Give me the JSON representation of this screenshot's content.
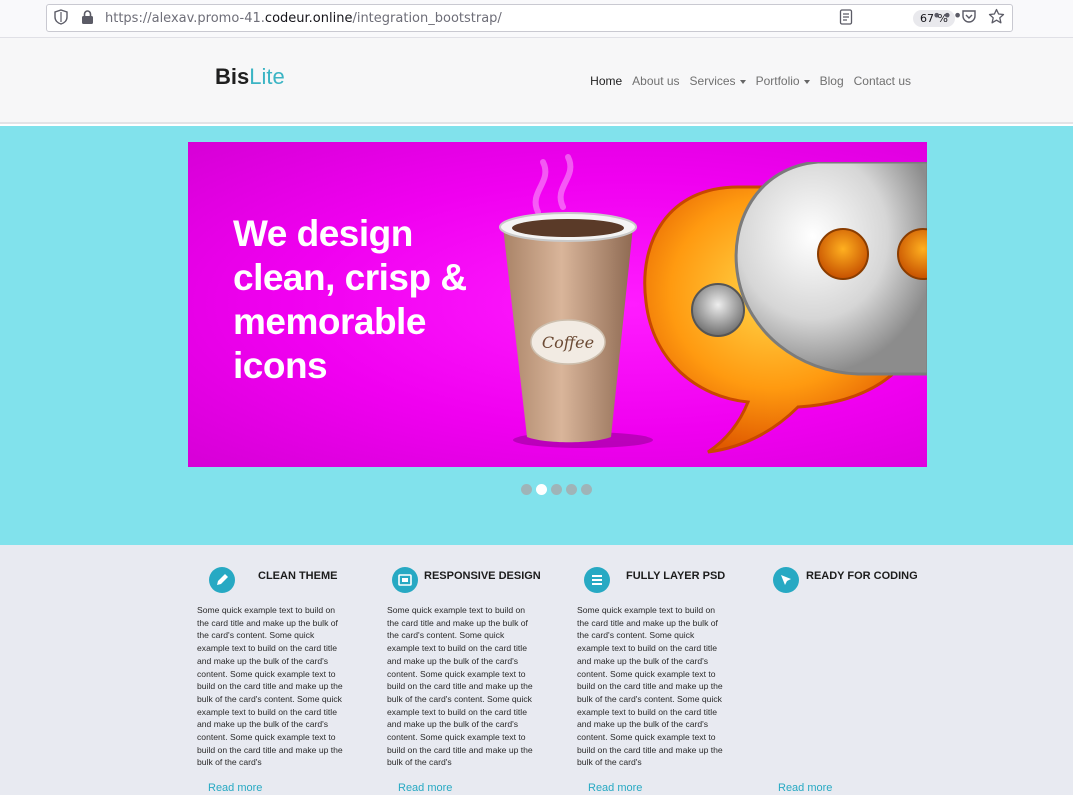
{
  "browser": {
    "url_prefix": "https://alexav.promo-41.",
    "url_domain": "codeur.online",
    "url_path": "/integration_bootstrap/",
    "zoom": "67 %"
  },
  "site": {
    "logo_bold": "Bis",
    "logo_light": "Lite",
    "nav": [
      {
        "label": "Home"
      },
      {
        "label": "About us"
      },
      {
        "label": "Services"
      },
      {
        "label": "Portfolio"
      },
      {
        "label": "Blog"
      },
      {
        "label": "Contact us"
      }
    ]
  },
  "hero": {
    "headline": "We design clean, crisp & memorable icons",
    "cup_label": "Coffee",
    "slides_total": 5,
    "active_slide": 2
  },
  "features": [
    {
      "title": "CLEAN THEME",
      "icon": "pencil-icon",
      "text": "Some quick example text to build on the card title and make up the bulk of the card's content. Some quick example text to build on the card title and make up the bulk of the card's content. Some quick example text to build on the card title and make up the bulk of the card's content. Some quick example text to build on the card title and make up the bulk of the card's content. Some quick example text to build on the card title and make up the bulk of the card's",
      "link": "Read more"
    },
    {
      "title": "RESPONSIVE DESIGN",
      "icon": "responsive-icon",
      "text": "Some quick example text to build on the card title and make up the bulk of the card's content. Some quick example text to build on the card title and make up the bulk of the card's content. Some quick example text to build on the card title and make up the bulk of the card's content. Some quick example text to build on the card title and make up the bulk of the card's content. Some quick example text to build on the card title and make up the bulk of the card's",
      "link": "Read more"
    },
    {
      "title": "FULLY LAYER PSD",
      "icon": "layers-icon",
      "text": "Some quick example text to build on the card title and make up the bulk of the card's content. Some quick example text to build on the card title and make up the bulk of the card's content. Some quick example text to build on the card title and make up the bulk of the card's content. Some quick example text to build on the card title and make up the bulk of the card's content. Some quick example text to build on the card title and make up the bulk of the card's",
      "link": "Read more"
    },
    {
      "title": "READY FOR CODING",
      "icon": "cursor-icon",
      "text": "",
      "link": "Read more"
    }
  ],
  "colors": {
    "accent": "#27a9c3",
    "hero_bg": "#81e2ec",
    "banner": "#f000f0"
  }
}
